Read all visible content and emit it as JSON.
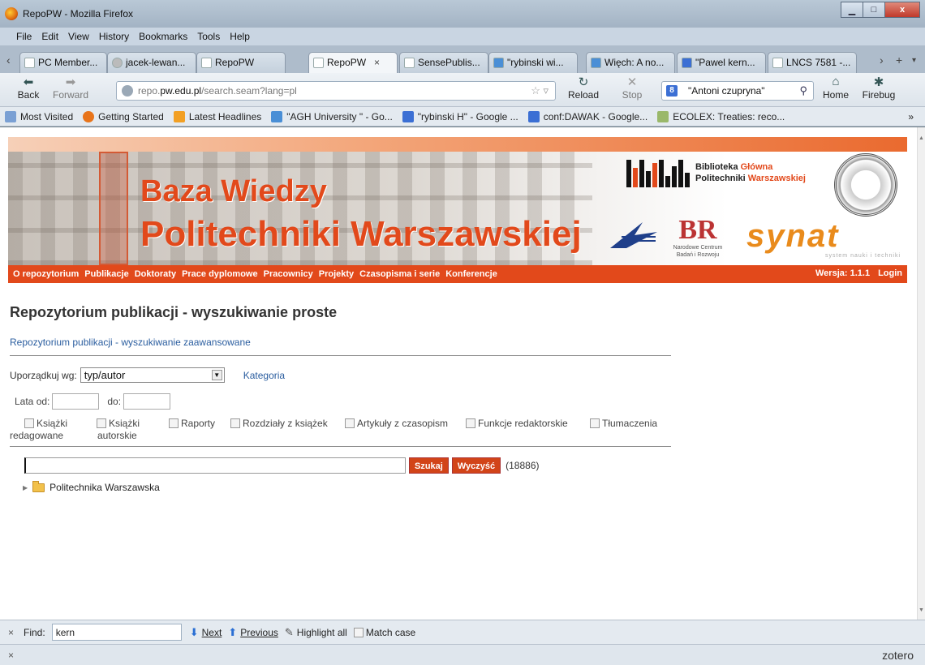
{
  "window": {
    "title": "RepoPW - Mozilla Firefox",
    "min": "▁",
    "max": "□",
    "close": "x"
  },
  "menu": [
    "File",
    "Edit",
    "View",
    "History",
    "Bookmarks",
    "Tools",
    "Help"
  ],
  "tabs": [
    {
      "label": "PC Member...",
      "icon": "page-icon"
    },
    {
      "label": "jacek-lewan...",
      "icon": "avatar-icon"
    },
    {
      "label": "RepoPW",
      "icon": "page-icon"
    },
    {
      "label": "RepoPW",
      "icon": "page-icon",
      "active": true
    },
    {
      "label": "SensePublis...",
      "icon": "page-icon"
    },
    {
      "label": "\"rybinski wi...",
      "icon": "agh-icon"
    },
    {
      "label": "Więch: A no...",
      "icon": "agh-icon"
    },
    {
      "label": "\"Pawel kern...",
      "icon": "google-icon"
    },
    {
      "label": "LNCS 7581 -...",
      "icon": "page-icon"
    }
  ],
  "tab_close": "×",
  "nav": {
    "back": "Back",
    "forward": "Forward",
    "reload": "Reload",
    "stop": "Stop",
    "home": "Home",
    "firebug": "Firebug",
    "url_prefix": "repo.",
    "url_host": "pw.edu.pl",
    "url_suffix": "/search.seam?lang=pl",
    "search_value": "\"Antoni czupryna\""
  },
  "bookmarks": [
    {
      "label": "Most Visited"
    },
    {
      "label": "Getting Started"
    },
    {
      "label": "Latest Headlines"
    },
    {
      "label": "\"AGH University \" - Go..."
    },
    {
      "label": "\"rybinski H\" - Google ..."
    },
    {
      "label": "conf:DAWAK - Google..."
    },
    {
      "label": "ECOLEX: Treaties: reco..."
    }
  ],
  "bookmarks_more": "»",
  "site": {
    "banner_line1": "Baza Wiedzy",
    "banner_line2": "Politechniki Warszawskiej",
    "library_1": "Biblioteka ",
    "library_1b": "Główna",
    "library_2": "Politechniki ",
    "library_2b": "Warszawskiej",
    "ncbr_small": "Narodowe Centrum Badań i Rozwoju",
    "synat_word": "synat",
    "synat_tag": "system nauki i techniki",
    "nav": [
      "O repozytorium",
      "Publikacje",
      "Doktoraty",
      "Prace dyplomowe",
      "Pracownicy",
      "Projekty",
      "Czasopisma i serie",
      "Konferencje"
    ],
    "version": "Wersja: 1.1.1",
    "login": "Login"
  },
  "page": {
    "title": "Repozytorium publikacji - wyszukiwanie proste",
    "advanced_link": "Repozytorium publikacji - wyszukiwanie zaawansowane",
    "sort_label": "Uporządkuj wg:",
    "sort_value": "typ/autor",
    "category_link": "Kategoria",
    "years_from": "Lata od:",
    "years_to": "do:",
    "checkboxes": [
      {
        "line1": "Książki",
        "line2": "redagowane"
      },
      {
        "line1": "Książki",
        "line2": "autorskie"
      },
      {
        "line1": "Raporty"
      },
      {
        "line1": "Rozdziały z książek"
      },
      {
        "line1": "Artykuły z czasopism"
      },
      {
        "line1": "Funkcje redaktorskie"
      },
      {
        "line1": "Tłumaczenia"
      }
    ],
    "search_button": "Szukaj",
    "clear_button": "Wyczyść",
    "result_count": "(18886)",
    "tree_root": "Politechnika Warszawska"
  },
  "findbar": {
    "close": "×",
    "label": "Find:",
    "value": "kern",
    "next": "Next",
    "previous": "Previous",
    "highlight": "Highlight all",
    "matchcase": "Match case"
  },
  "status": {
    "close": "×",
    "zotero": "zotero"
  }
}
